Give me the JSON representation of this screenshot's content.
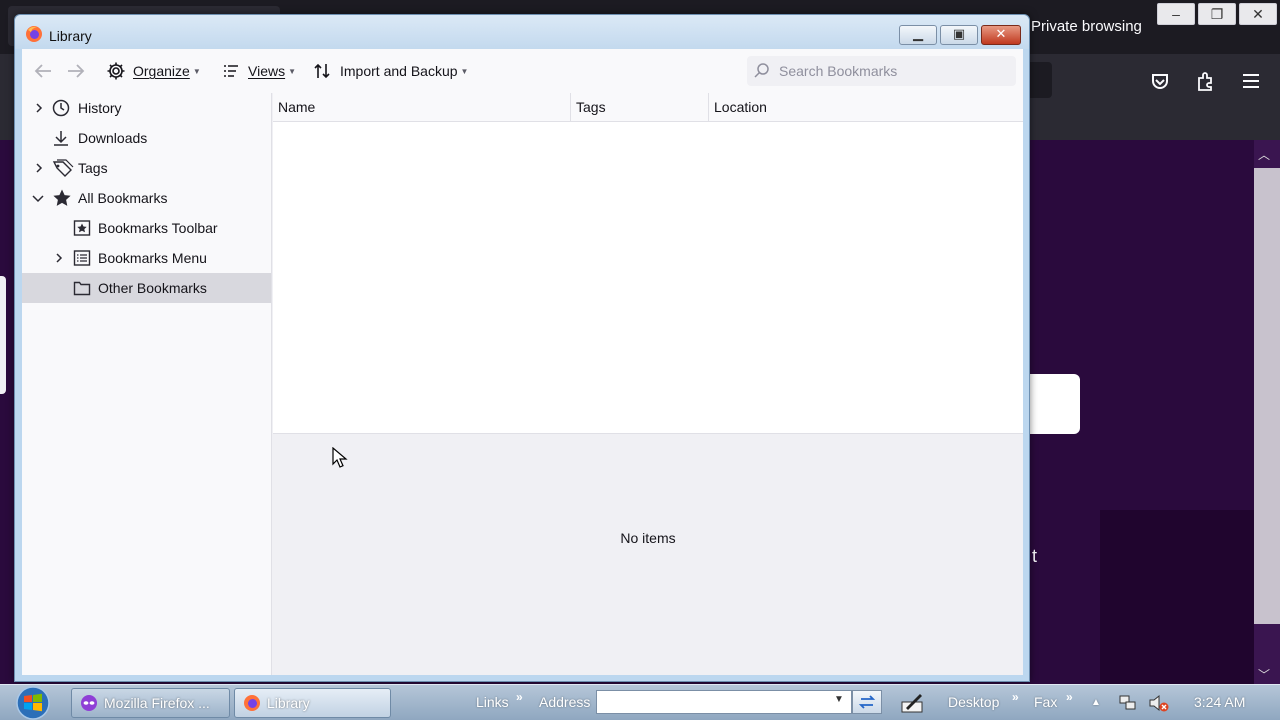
{
  "background": {
    "private_label": "Private browsing",
    "page_fragment": "t"
  },
  "window": {
    "title": "Library"
  },
  "toolbar": {
    "organize": "Organize",
    "views": "Views",
    "import_backup": "Import and Backup",
    "search_placeholder": "Search Bookmarks"
  },
  "sidebar": {
    "items": [
      {
        "label": "History",
        "icon": "clock-icon",
        "expandable": true,
        "expanded": false
      },
      {
        "label": "Downloads",
        "icon": "download-icon",
        "expandable": false
      },
      {
        "label": "Tags",
        "icon": "tag-icon",
        "expandable": true,
        "expanded": false
      },
      {
        "label": "All Bookmarks",
        "icon": "star-icon",
        "expandable": true,
        "expanded": true
      },
      {
        "label": "Bookmarks Toolbar",
        "icon": "bookmarks-toolbar-icon",
        "expandable": false
      },
      {
        "label": "Bookmarks Menu",
        "icon": "bookmarks-menu-icon",
        "expandable": true,
        "expanded": false
      },
      {
        "label": "Other Bookmarks",
        "icon": "folder-icon",
        "expandable": false,
        "selected": true
      }
    ]
  },
  "columns": [
    "Name",
    "Tags",
    "Location"
  ],
  "details": {
    "empty_text": "No items"
  },
  "taskbar": {
    "tasks": [
      {
        "label": "Mozilla Firefox ...",
        "icon": "firefox-private-icon"
      },
      {
        "label": "Library",
        "icon": "firefox-icon",
        "active": true
      }
    ],
    "links_label": "Links",
    "address_label": "Address",
    "desktop_label": "Desktop",
    "fax_label": "Fax",
    "clock": "3:24 AM"
  },
  "colors": {
    "selected_row": "#d8d8de",
    "background_page": "#2a0a3d",
    "taskbar": "#9db3ca"
  }
}
